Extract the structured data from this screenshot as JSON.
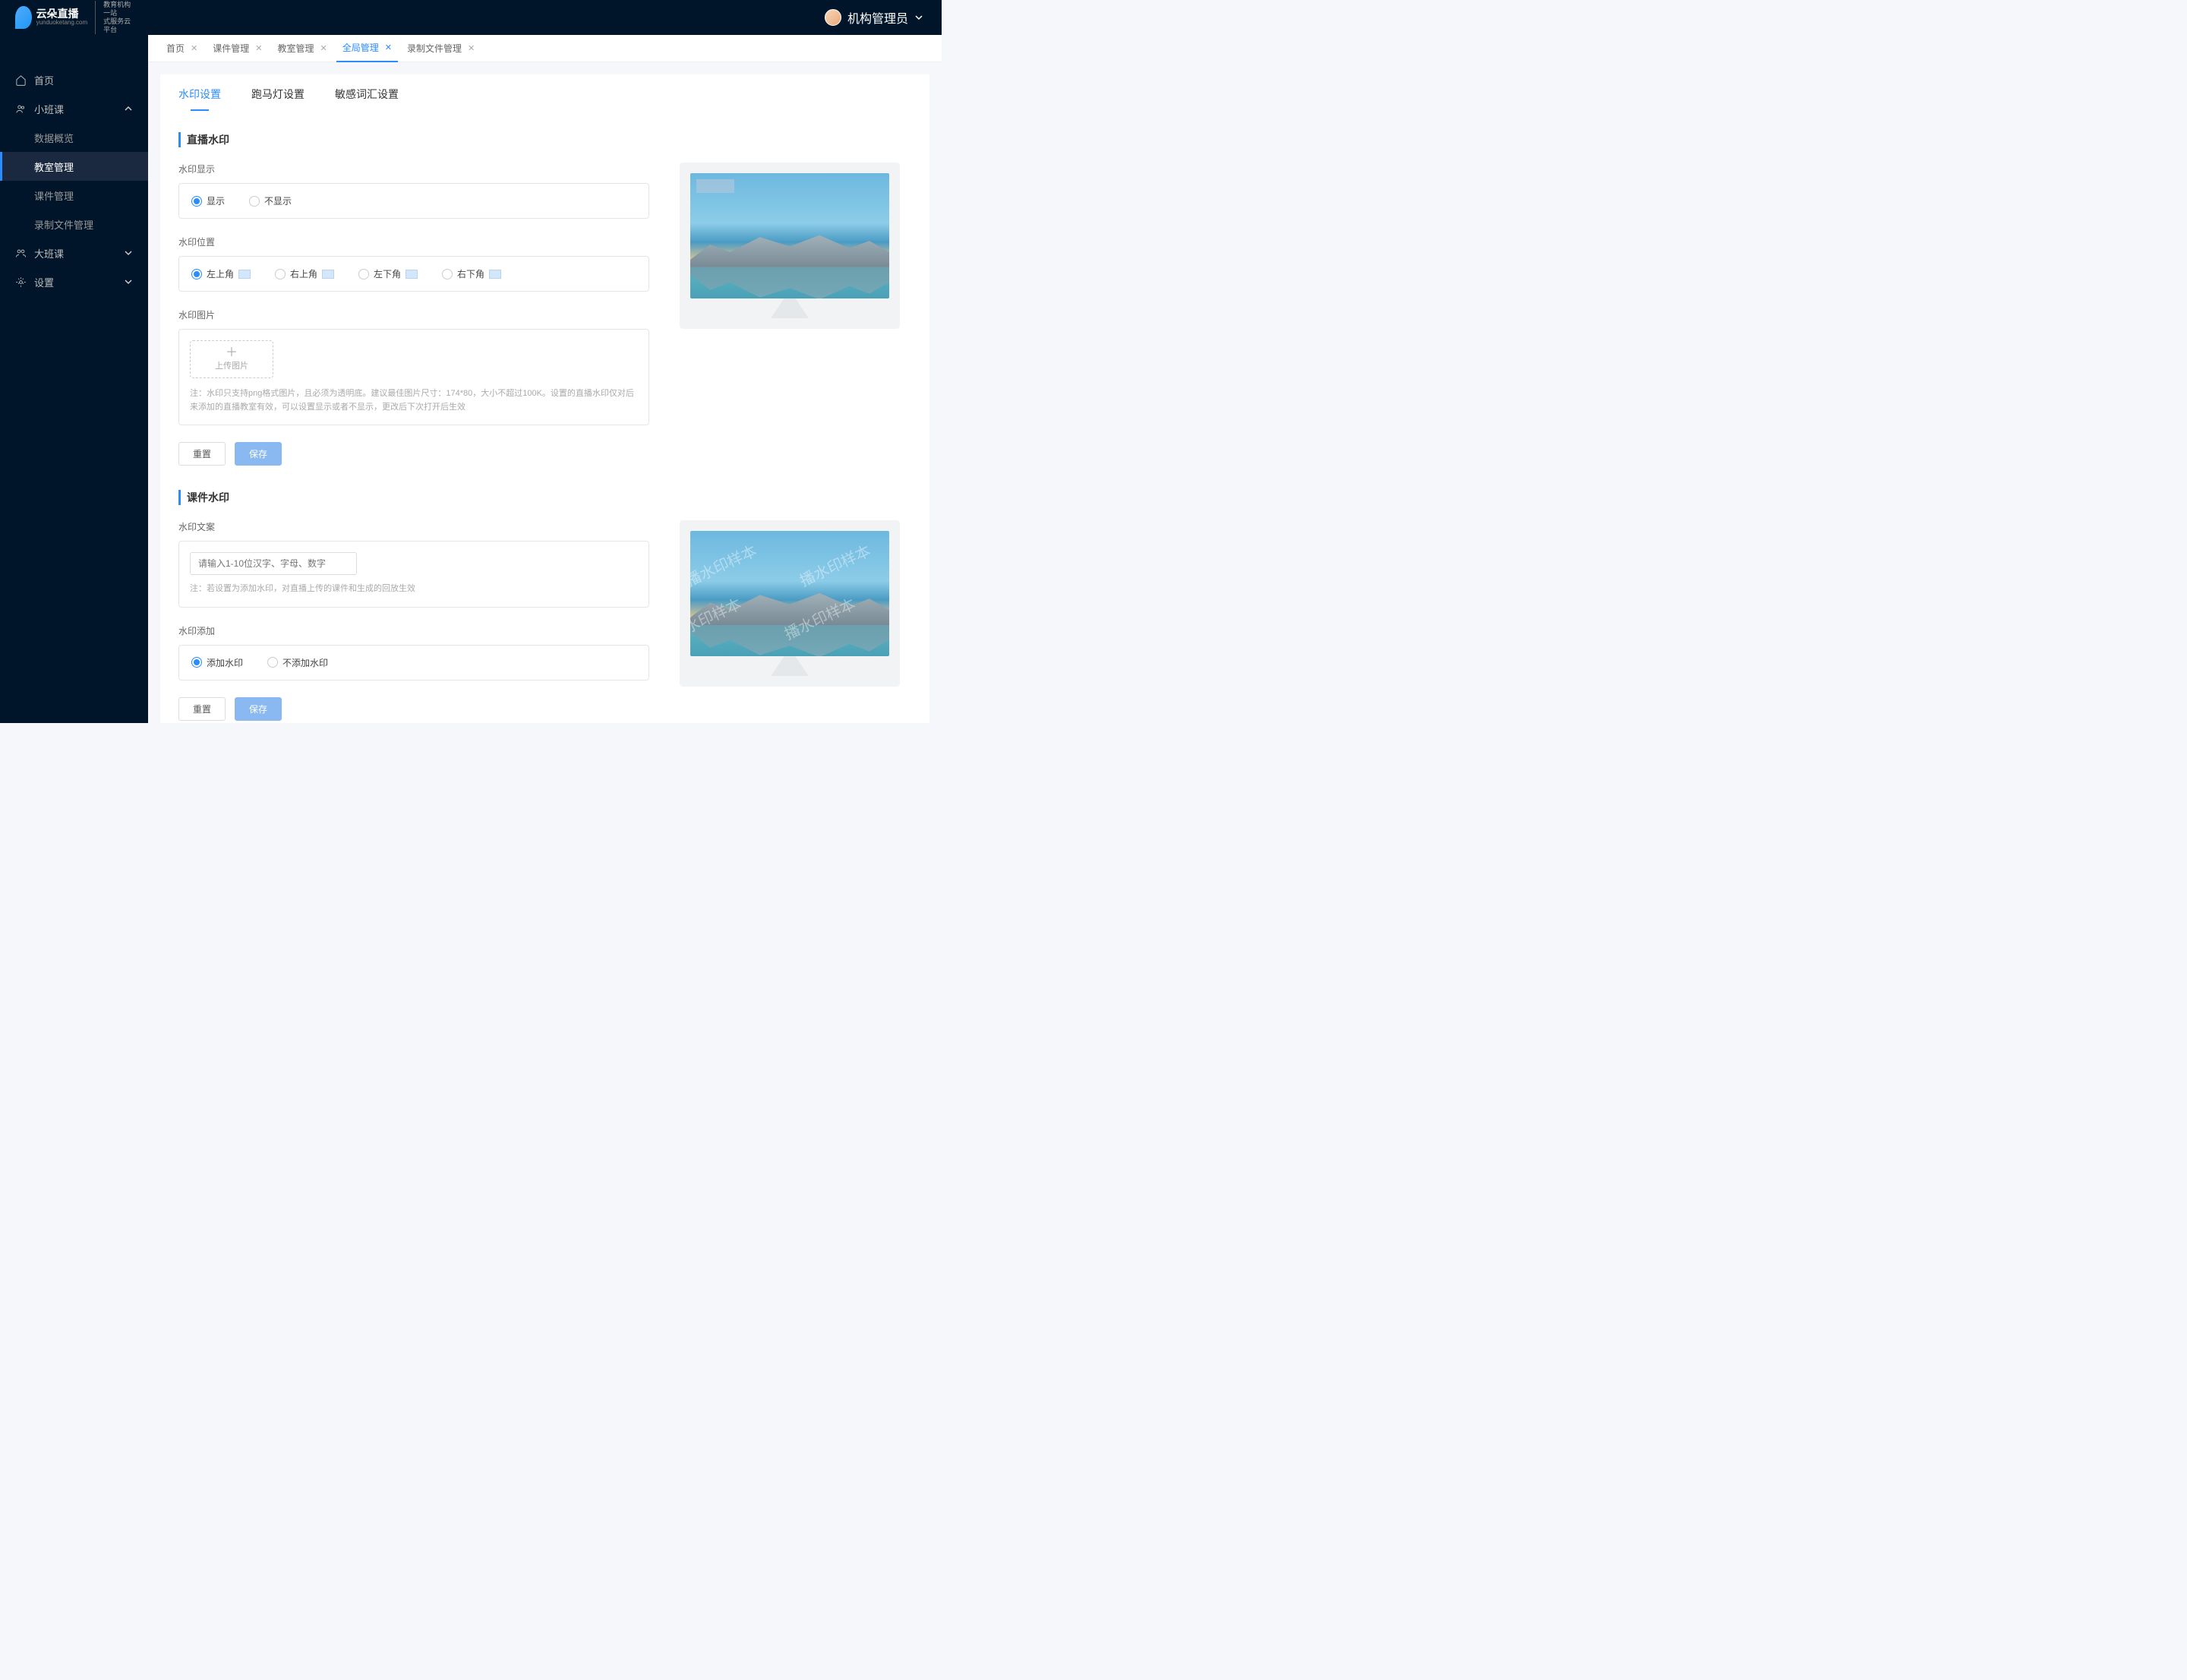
{
  "header": {
    "user_name": "机构管理员"
  },
  "logo": {
    "title": "云朵直播",
    "sub": "yunduoketang.com",
    "tag1": "教育机构一站",
    "tag2": "式服务云平台"
  },
  "sidebar": {
    "home": "首页",
    "small_class": "小班课",
    "sub_data": "数据概览",
    "sub_classroom": "教室管理",
    "sub_courseware": "课件管理",
    "sub_recording": "录制文件管理",
    "big_class": "大班课",
    "settings": "设置"
  },
  "tabs": {
    "home": "首页",
    "courseware": "课件管理",
    "classroom": "教室管理",
    "global": "全局管理",
    "recording": "录制文件管理"
  },
  "inner_tabs": {
    "watermark": "水印设置",
    "marquee": "跑马灯设置",
    "sensitive": "敏感词汇设置"
  },
  "live_wm": {
    "title": "直播水印",
    "show_label": "水印显示",
    "show_opt1": "显示",
    "show_opt2": "不显示",
    "pos_label": "水印位置",
    "pos_tl": "左上角",
    "pos_tr": "右上角",
    "pos_bl": "左下角",
    "pos_br": "右下角",
    "img_label": "水印图片",
    "upload_text": "上传图片",
    "note": "注：水印只支持png格式图片，且必须为透明底。建议最佳图片尺寸：174*80，大小不超过100K。设置的直播水印仅对后来添加的直播教室有效，可以设置显示或者不显示，更改后下次打开后生效",
    "reset": "重置",
    "save": "保存"
  },
  "course_wm": {
    "title": "课件水印",
    "text_label": "水印文案",
    "placeholder": "请输入1-10位汉字、字母、数字",
    "note": "注：若设置为添加水印，对直播上传的课件和生成的回放生效",
    "add_label": "水印添加",
    "add_opt1": "添加水印",
    "add_opt2": "不添加水印",
    "reset": "重置",
    "save": "保存",
    "sample_text": "播水印样本"
  }
}
